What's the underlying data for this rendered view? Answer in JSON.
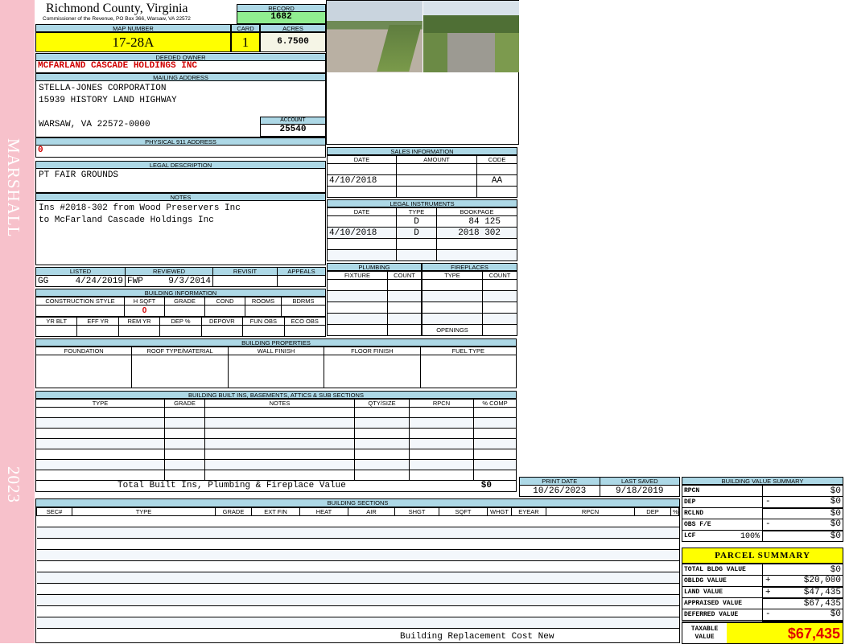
{
  "sidebar": {
    "district": "MARSHALL",
    "year": "2023"
  },
  "header": {
    "county": "Richmond County, Virginia",
    "subtitle": "Commissioner of the Revenue, PO Box 366, Warsaw, VA 22572",
    "record_label": "RECORD",
    "record": "1682"
  },
  "parcel": {
    "map_label": "MAP NUMBER",
    "map": "17-28A",
    "card_label": "CARD",
    "card": "1",
    "acres_label": "ACRES",
    "acres": "6.7500"
  },
  "owner": {
    "label": "DEEDED OWNER",
    "name": "MCFARLAND CASCADE HOLDINGS INC"
  },
  "mailing": {
    "label": "MAILING ADDRESS",
    "line1": "STELLA-JONES CORPORATION",
    "line2": "15939 HISTORY LAND HIGHWAY",
    "line3": "WARSAW, VA 22572-0000",
    "account_label": "ACCOUNT",
    "account": "25540"
  },
  "physical": {
    "label": "PHYSICAL 911 ADDRESS",
    "value": "0"
  },
  "legal": {
    "label": "LEGAL DESCRIPTION",
    "value": "PT FAIR GROUNDS"
  },
  "notes": {
    "label": "NOTES",
    "line1": "Ins #2018-302 from Wood Preservers Inc",
    "line2": "to McFarland Cascade Holdings Inc"
  },
  "review": {
    "listed_label": "LISTED",
    "listed_by": "GG",
    "listed_date": "4/24/2019",
    "reviewed_label": "REVIEWED",
    "reviewed_by": "FWP",
    "reviewed_date": "9/3/2014",
    "revisit_label": "REVISIT",
    "appeals_label": "APPEALS"
  },
  "building_info": {
    "label": "BUILDING INFORMATION",
    "cols1": [
      "CONSTRUCTION STYLE",
      "H SQFT",
      "GRADE",
      "COND",
      "ROOMS",
      "BDRMS"
    ],
    "hsqft": "0",
    "cols2": [
      "YR BLT",
      "EFF YR",
      "REM YR",
      "DEP %",
      "DEPOVR",
      "FUN OBS",
      "ECO OBS"
    ]
  },
  "sales": {
    "label": "SALES INFORMATION",
    "cols": [
      "DATE",
      "AMOUNT",
      "CODE"
    ],
    "rows": [
      [
        "",
        "",
        ""
      ],
      [
        "4/10/2018",
        "",
        "AA"
      ],
      [
        "",
        "",
        ""
      ]
    ]
  },
  "instruments": {
    "label": "LEGAL INSTRUMENTS",
    "cols": [
      "DATE",
      "TYPE",
      "BOOKPAGE"
    ],
    "rows": [
      [
        "",
        "D",
        "84 125"
      ],
      [
        "4/10/2018",
        "D",
        "2018 302"
      ],
      [
        "",
        "",
        ""
      ],
      [
        "",
        "",
        ""
      ]
    ]
  },
  "plumbing": {
    "label": "PLUMBING",
    "cols": [
      "FIXTURE",
      "COUNT"
    ]
  },
  "fireplaces": {
    "label": "FIREPLACES",
    "cols": [
      "TYPE",
      "COUNT"
    ],
    "openings_label": "OPENINGS"
  },
  "properties": {
    "label": "BUILDING PROPERTIES",
    "cols": [
      "FOUNDATION",
      "ROOF TYPE/MATERIAL",
      "WALL FINISH",
      "FLOOR FINISH",
      "FUEL TYPE"
    ]
  },
  "builtins": {
    "label": "BUILDING BUILT INS, BASEMENTS, ATTICS & SUB SECTIONS",
    "cols": [
      "TYPE",
      "GRADE",
      "NOTES",
      "QTY/SIZE",
      "RPCN",
      "% COMP"
    ],
    "total_label": "Total Built Ins, Plumbing & Fireplace Value",
    "total": "$0"
  },
  "dates": {
    "print_label": "PRINT DATE",
    "print": "10/26/2023",
    "saved_label": "LAST SAVED",
    "saved": "9/18/2019"
  },
  "sections": {
    "label": "BUILDING SECTIONS",
    "cols": [
      "SEC#",
      "TYPE",
      "GRADE",
      "EXT FIN",
      "HEAT",
      "AIR",
      "SHGT",
      "SQFT",
      "WHGT",
      "EYEAR",
      "RPCN",
      "DEP",
      "% COMP"
    ],
    "footer": "Building Replacement Cost New"
  },
  "value_summary": {
    "label": "BUILDING VALUE SUMMARY",
    "rows": [
      {
        "label": "RPCN",
        "op": "",
        "value": "$0"
      },
      {
        "label": "DEP",
        "op": "-",
        "value": "$0"
      },
      {
        "label": "RCLND",
        "op": "",
        "value": "$0"
      },
      {
        "label": "OBS F/E",
        "op": "-",
        "value": "$0"
      },
      {
        "label": "LCF",
        "pct": "100%",
        "op": "",
        "value": "$0"
      }
    ]
  },
  "parcel_summary": {
    "label": "PARCEL SUMMARY",
    "rows": [
      {
        "label": "TOTAL BLDG VALUE",
        "op": "",
        "value": "$0"
      },
      {
        "label": "OBLDG VALUE",
        "op": "+",
        "value": "$20,000"
      },
      {
        "label": "LAND VALUE",
        "op": "+",
        "value": "$47,435"
      },
      {
        "label": "APPRAISED VALUE",
        "op": "",
        "value": "$67,435"
      },
      {
        "label": "DEFERRED VALUE",
        "op": "-",
        "value": "$0"
      }
    ],
    "taxable_label": "TAXABLE VALUE",
    "taxable": "$67,435"
  },
  "colors": {
    "header_blue": "#add8e6",
    "map_yellow": "#ffff00",
    "record_green": "#90ee90",
    "owner_red": "#d00000",
    "sidebar_pink": "#f7c1cb"
  }
}
